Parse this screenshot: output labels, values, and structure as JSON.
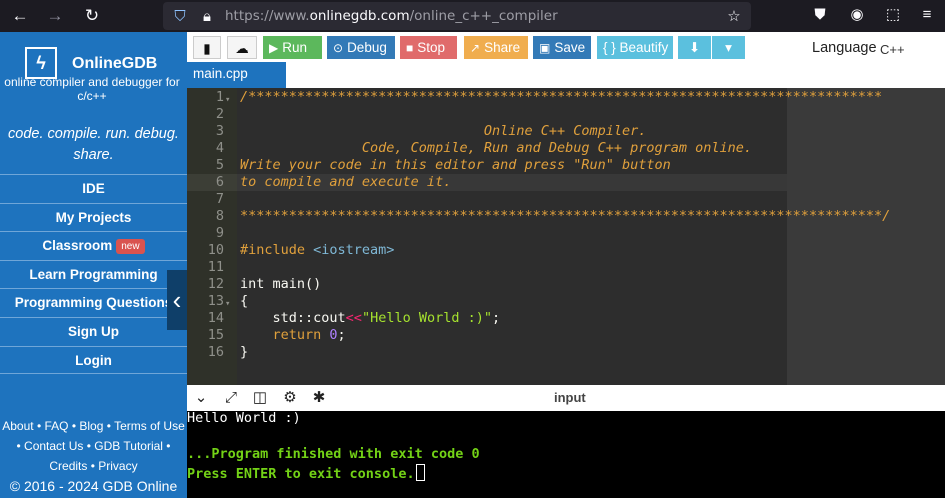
{
  "browser": {
    "url_prefix": "https://www.",
    "url_host": "onlinegdb.com",
    "url_path": "/online_c++_compiler"
  },
  "sidebar": {
    "brand": "OnlineGDB",
    "brand_sub": "online compiler and debugger for c/c++",
    "tagline": "code. compile. run. debug. share.",
    "items": [
      {
        "label": "IDE"
      },
      {
        "label": "My Projects"
      },
      {
        "label": "Classroom",
        "badge": "new"
      },
      {
        "label": "Learn Programming"
      },
      {
        "label": "Programming Questions"
      },
      {
        "label": "Sign Up"
      },
      {
        "label": "Login"
      }
    ],
    "footer": {
      "about": "About",
      "faq": "FAQ",
      "blog": "Blog",
      "terms": "Terms of Use",
      "contact": "Contact Us",
      "tutorial": "GDB Tutorial",
      "credits": "Credits",
      "privacy": "Privacy",
      "copyright": "© 2016 - 2024 GDB Online"
    }
  },
  "toolbar": {
    "run": "Run",
    "debug": "Debug",
    "stop": "Stop",
    "share": "Share",
    "save": "Save",
    "beautify": "{ } Beautify",
    "language_label": "Language",
    "language_value": "C++"
  },
  "tabs": [
    {
      "label": "main.cpp"
    }
  ],
  "editor": {
    "lines": [
      {
        "n": "1",
        "text": "/******************************************************************************"
      },
      {
        "n": "2",
        "text": ""
      },
      {
        "n": "3",
        "text": "                              Online C++ Compiler."
      },
      {
        "n": "4",
        "text": "               Code, Compile, Run and Debug C++ program online."
      },
      {
        "n": "5",
        "text": "Write your code in this editor and press \"Run\" button"
      },
      {
        "n": "6",
        "text": "to compile and execute it."
      },
      {
        "n": "7",
        "text": ""
      },
      {
        "n": "8",
        "text": "*******************************************************************************/"
      },
      {
        "n": "9",
        "text": ""
      },
      {
        "n": "10",
        "pre": "#include ",
        "inc": "<iostream>"
      },
      {
        "n": "11",
        "text": ""
      },
      {
        "n": "12",
        "text": "int main()"
      },
      {
        "n": "13",
        "text": "{"
      },
      {
        "n": "14",
        "a": "    std::cout",
        "op": "<<",
        "str": "\"Hello World :)\"",
        "b": ";"
      },
      {
        "n": "15",
        "kw": "    return ",
        "num": "0",
        "b": ";"
      },
      {
        "n": "16",
        "text": "}"
      }
    ]
  },
  "console": {
    "input_label": "input",
    "lines": [
      {
        "text": "Hello World :)"
      },
      {
        "text": ""
      },
      {
        "text": "...Program finished with exit code 0"
      },
      {
        "text": "Press ENTER to exit console."
      }
    ]
  }
}
